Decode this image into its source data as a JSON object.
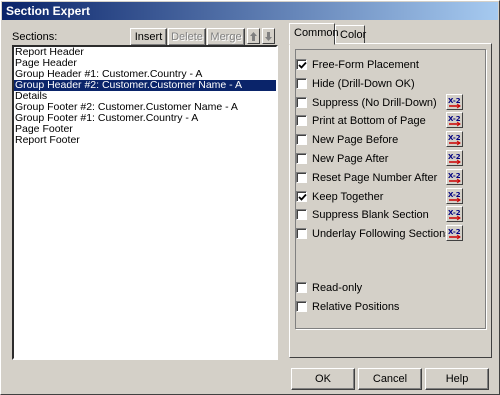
{
  "window": {
    "title": "Section Expert"
  },
  "sections": {
    "label": "Sections:",
    "buttons": {
      "insert": "Insert",
      "delete": "Delete",
      "merge": "Merge"
    },
    "items": [
      "Report Header",
      "Page Header",
      "Group Header #1: Customer.Country - A",
      "Group Header #2: Customer.Customer Name - A",
      "Details",
      "Group Footer #2: Customer.Customer Name - A",
      "Group Footer #1: Customer.Country - A",
      "Page Footer",
      "Report Footer"
    ],
    "selected_index": 3
  },
  "tabs": [
    "Common",
    "Color"
  ],
  "common": {
    "options": [
      {
        "label": "Free-Form Placement",
        "checked": true,
        "formula": false
      },
      {
        "label": "Hide (Drill-Down OK)",
        "checked": false,
        "formula": false
      },
      {
        "label": "Suppress (No Drill-Down)",
        "checked": false,
        "formula": true
      },
      {
        "label": "Print at Bottom of Page",
        "checked": false,
        "formula": true
      },
      {
        "label": "New Page Before",
        "checked": false,
        "formula": true
      },
      {
        "label": "New Page After",
        "checked": false,
        "formula": true
      },
      {
        "label": "Reset Page Number After",
        "checked": false,
        "formula": true
      },
      {
        "label": "Keep Together",
        "checked": true,
        "formula": true
      },
      {
        "label": "Suppress Blank Section",
        "checked": false,
        "formula": true
      },
      {
        "label": "Underlay Following Sections",
        "checked": false,
        "formula": true
      }
    ],
    "lower_options": [
      {
        "label": "Read-only",
        "checked": false
      },
      {
        "label": "Relative Positions",
        "checked": false
      }
    ]
  },
  "footer": {
    "ok": "OK",
    "cancel": "Cancel",
    "help": "Help"
  }
}
